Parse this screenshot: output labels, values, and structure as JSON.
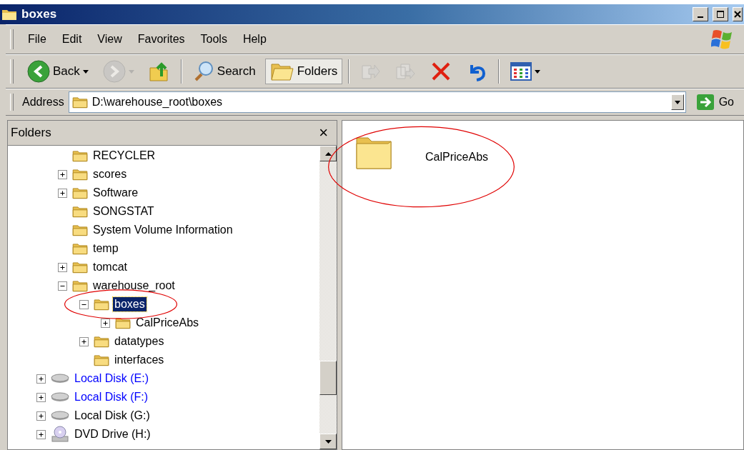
{
  "window": {
    "title": "boxes"
  },
  "menu": [
    "File",
    "Edit",
    "View",
    "Favorites",
    "Tools",
    "Help"
  ],
  "toolbar": [
    {
      "kind": "back",
      "label": "Back",
      "disabled": false
    },
    {
      "kind": "forward",
      "disabled": true
    },
    {
      "kind": "up",
      "disabled": false
    },
    {
      "kind": "separator"
    },
    {
      "kind": "search",
      "label": "Search",
      "selected": false
    },
    {
      "kind": "folders",
      "label": "Folders",
      "selected": true
    },
    {
      "kind": "separator"
    },
    {
      "kind": "move",
      "disabled": true
    },
    {
      "kind": "copy",
      "disabled": true
    },
    {
      "kind": "delete",
      "disabled": false
    },
    {
      "kind": "undo",
      "disabled": false
    },
    {
      "kind": "separator"
    },
    {
      "kind": "views",
      "disabled": false
    }
  ],
  "address": {
    "label": "Address",
    "value": "D:\\warehouse_root\\boxes",
    "go": "Go"
  },
  "folders_pane": {
    "title": "Folders",
    "close": "×",
    "folders": [
      {
        "label": "RECYCLER",
        "kind": "leaf",
        "selected": false,
        "circled": false
      },
      {
        "label": "scores",
        "kind": "collapsed",
        "selected": false,
        "circled": false
      },
      {
        "label": "Software",
        "kind": "collapsed",
        "selected": false,
        "circled": false
      },
      {
        "label": "SONGSTAT",
        "kind": "leaf",
        "selected": false,
        "circled": false
      },
      {
        "label": "System Volume Information",
        "kind": "leaf",
        "selected": false,
        "circled": false
      },
      {
        "label": "temp",
        "kind": "leaf",
        "selected": false,
        "circled": false
      },
      {
        "label": "tomcat",
        "kind": "collapsed",
        "selected": false,
        "circled": false
      },
      {
        "label": "warehouse_root",
        "kind": "expanded",
        "selected": false,
        "circled": false,
        "children": [
          {
            "label": "boxes",
            "kind": "expanded",
            "selected": true,
            "circled": true,
            "children": [
              {
                "label": "CalPriceAbs",
                "kind": "collapsed",
                "selected": false,
                "circled": false
              }
            ]
          },
          {
            "label": "datatypes",
            "kind": "collapsed",
            "selected": false,
            "circled": false
          },
          {
            "label": "interfaces",
            "kind": "leaf",
            "selected": false,
            "circled": false
          }
        ]
      }
    ],
    "drives": [
      {
        "label": "Local Disk (E:)",
        "kind": "disk",
        "color": "#0000ff"
      },
      {
        "label": "Local Disk (F:)",
        "kind": "disk",
        "color": "#0000ff"
      },
      {
        "label": "Local Disk (G:)",
        "kind": "disk",
        "color": "#000000"
      },
      {
        "label": "DVD Drive (H:)",
        "kind": "dvd",
        "color": "#000000"
      }
    ]
  },
  "contents": [
    {
      "label": "CalPriceAbs",
      "circled": true
    }
  ]
}
